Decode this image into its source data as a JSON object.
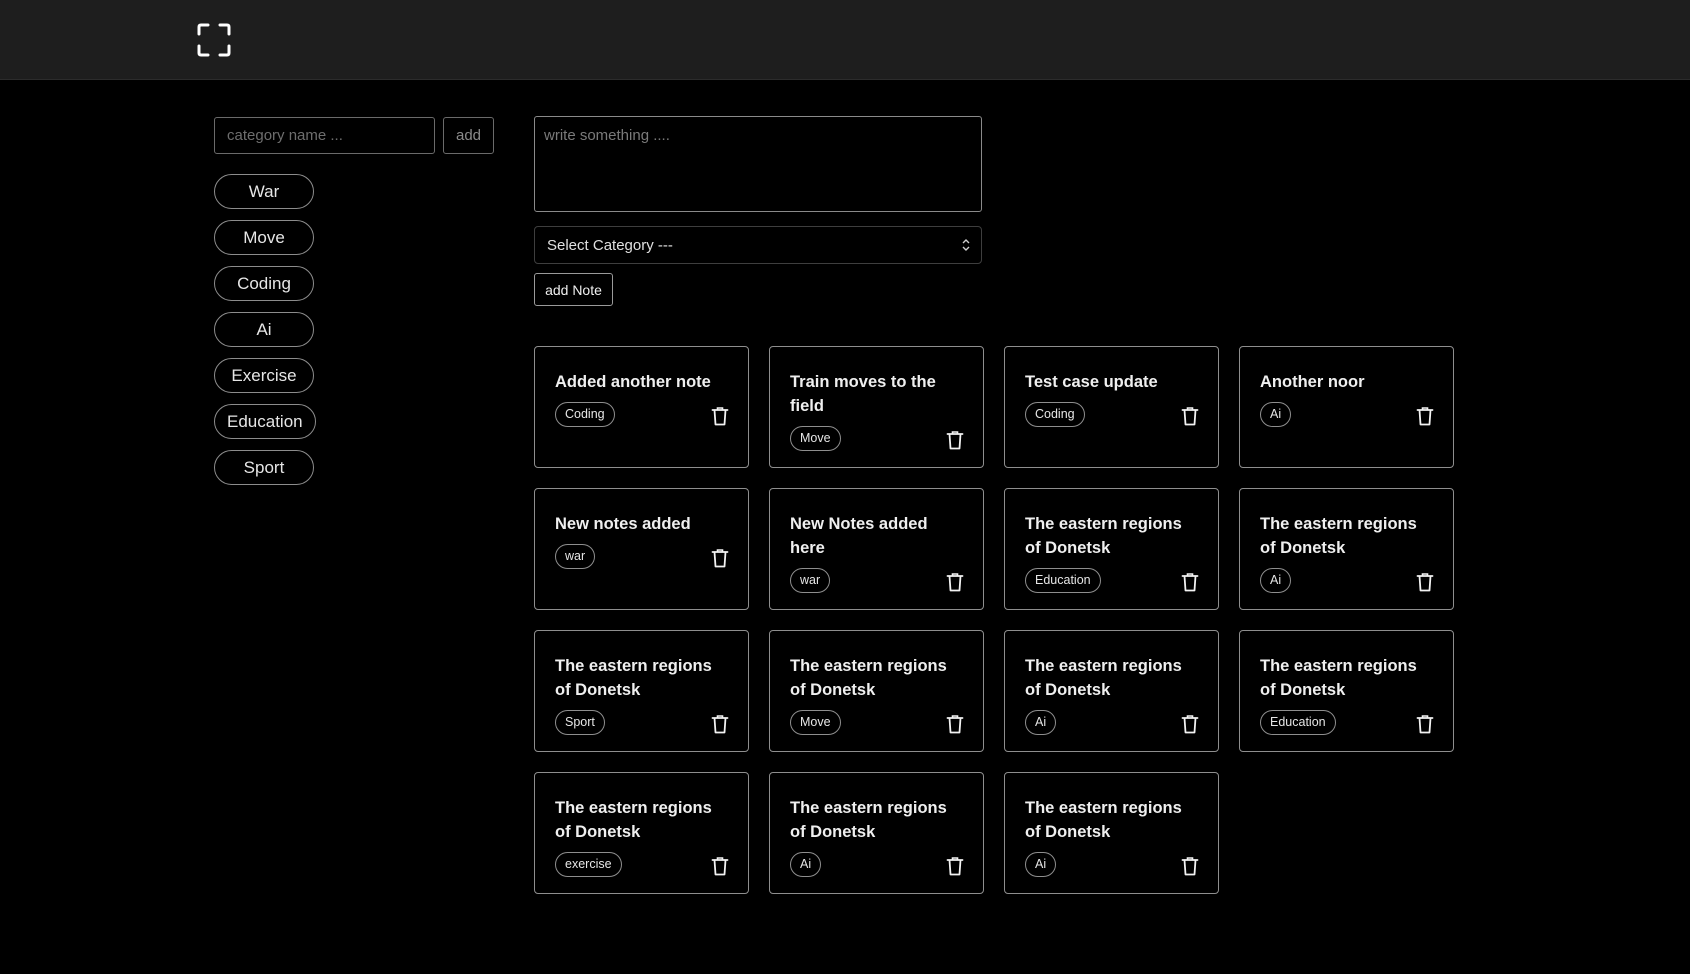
{
  "header": {
    "logo_icon": "fullscreen-icon"
  },
  "categories": {
    "input_placeholder": "category name ...",
    "add_label": "add",
    "items": [
      "War",
      "Move",
      "Coding",
      "Ai",
      "Exercise",
      "Education",
      "Sport"
    ]
  },
  "composer": {
    "textarea_placeholder": "write something ....",
    "select_value": "Select Category ---",
    "add_note_label": "add Note"
  },
  "notes": [
    {
      "title": "Added another note",
      "tag": "Coding"
    },
    {
      "title": "Train moves to the field",
      "tag": "Move"
    },
    {
      "title": "Test case update",
      "tag": "Coding"
    },
    {
      "title": "Another noor",
      "tag": "Ai"
    },
    {
      "title": "New notes added",
      "tag": "war"
    },
    {
      "title": "New Notes added here",
      "tag": "war"
    },
    {
      "title": "The eastern regions of Donetsk",
      "tag": "Education"
    },
    {
      "title": "The eastern regions of Donetsk",
      "tag": "Ai"
    },
    {
      "title": "The eastern regions of Donetsk",
      "tag": "Sport"
    },
    {
      "title": "The eastern regions of Donetsk",
      "tag": "Move"
    },
    {
      "title": "The eastern regions of Donetsk",
      "tag": "Ai"
    },
    {
      "title": "The eastern regions of Donetsk",
      "tag": "Education"
    },
    {
      "title": "The eastern regions of Donetsk",
      "tag": "exercise"
    },
    {
      "title": "The eastern regions of Donetsk",
      "tag": "Ai"
    },
    {
      "title": "The eastern regions of Donetsk",
      "tag": "Ai"
    }
  ],
  "icons": {
    "delete": "trash-icon",
    "select": "chevron-up-down-icon"
  },
  "colors": {
    "background": "#000000",
    "topbar": "#1e1e1e",
    "border": "#8e8e8e"
  }
}
